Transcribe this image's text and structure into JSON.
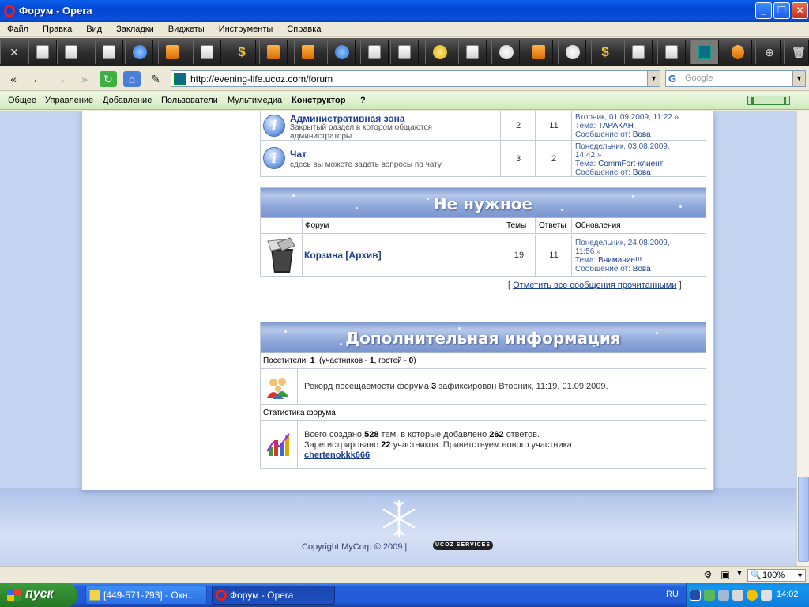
{
  "window": {
    "title": "Форум - Opera"
  },
  "menu": [
    "Файл",
    "Правка",
    "Вид",
    "Закладки",
    "Виджеты",
    "Инструменты",
    "Справка"
  ],
  "address": {
    "url": "http://evening-life.ucoz.com/forum",
    "search_placeholder": "Google"
  },
  "ucoz_panel": {
    "items": [
      "Общее",
      "Управление",
      "Добавление",
      "Пользователи",
      "Мультимедиа"
    ],
    "active": "Конструктор",
    "help": "?"
  },
  "forums_top": [
    {
      "title": "Административная зона",
      "desc_line1": "Закрытый раздел в котором общаются",
      "desc_line2": "администраторы.",
      "topics": "2",
      "replies": "11",
      "upd_date": "Вторник, 01.09.2009, 11:22 »",
      "upd_date2": "",
      "upd_topic_label": "Тема:",
      "upd_topic": "ТАРАКАН",
      "upd_author_label": "Сообщение от:",
      "upd_author": "Вова"
    },
    {
      "title": "Чат",
      "desc_line1": "сдесь вы можете задать вопросы по чату",
      "desc_line2": "",
      "topics": "3",
      "replies": "2",
      "upd_date": "Понедельник, 03.08.2009,",
      "upd_date2": "14:42 »",
      "upd_topic_label": "Тема:",
      "upd_topic": "CommFort-клиент",
      "upd_author_label": "Сообщение от:",
      "upd_author": "Вова"
    }
  ],
  "section_trash": {
    "header": "Не нужное",
    "col_forum": "Форум",
    "col_topics": "Темы",
    "col_replies": "Ответы",
    "col_updates": "Обновления",
    "forum": {
      "title": "Корзина [Архив]",
      "topics": "19",
      "replies": "11",
      "upd_date": "Понедельник, 24.08.2009,",
      "upd_date2": "11:56 »",
      "upd_topic_label": "Тема:",
      "upd_topic": "Внимание!!!",
      "upd_author_label": "Сообщение от:",
      "upd_author": "Вова"
    }
  },
  "mark_read": {
    "open": "[",
    "link": "Отметить все сообщения прочитанными",
    "close": "]"
  },
  "info": {
    "header": "Дополнительная информация",
    "visitors_label": "Посетители:",
    "visitors_count": "1",
    "visitors_detail_a": "(участников -",
    "visitors_members": "1",
    "visitors_detail_b": ", гостей -",
    "visitors_guests": "0",
    "visitors_detail_c": ")",
    "record_a": "Рекорд посещаемости форума",
    "record_num": "3",
    "record_b": "зафиксирован Вторник, 11:19, 01.09.2009.",
    "stats_label": "Статистика форума",
    "stats_a": "Всего создано",
    "stats_topics": "528",
    "stats_b": "тем, в которые добавлено",
    "stats_replies": "262",
    "stats_c": "ответов.",
    "stats_d": "Зарегистрировано",
    "stats_users": "22",
    "stats_e": "участников. Приветствуем нового участника",
    "stats_newuser": "chertenokkk666",
    "stats_f": "."
  },
  "footer": {
    "copyright": "Copyright MyCorp © 2009 |",
    "badge": "UCOZ SERVICES"
  },
  "status": {
    "zoom": "100%"
  },
  "taskbar": {
    "start": "пуск",
    "task1": "[449-571-793] - Окн...",
    "task2": "Форум - Opera",
    "lang": "RU",
    "clock": "14:02"
  },
  "colors": {
    "title_bar": "#0A5FE8",
    "ucoz_bar": "#cfeabd",
    "page_bg": "#c4d3f0",
    "section_header": "#90aadb",
    "link": "#1a3e8c"
  }
}
